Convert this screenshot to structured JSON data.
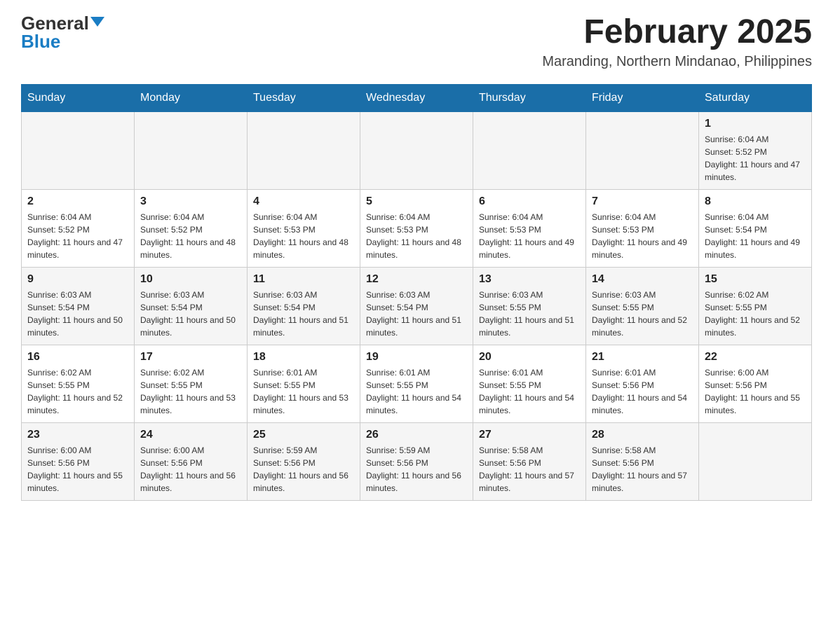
{
  "header": {
    "logo_general": "General",
    "logo_blue": "Blue",
    "month_title": "February 2025",
    "location": "Maranding, Northern Mindanao, Philippines"
  },
  "weekdays": [
    "Sunday",
    "Monday",
    "Tuesday",
    "Wednesday",
    "Thursday",
    "Friday",
    "Saturday"
  ],
  "weeks": [
    [
      {
        "day": "",
        "info": ""
      },
      {
        "day": "",
        "info": ""
      },
      {
        "day": "",
        "info": ""
      },
      {
        "day": "",
        "info": ""
      },
      {
        "day": "",
        "info": ""
      },
      {
        "day": "",
        "info": ""
      },
      {
        "day": "1",
        "info": "Sunrise: 6:04 AM\nSunset: 5:52 PM\nDaylight: 11 hours and 47 minutes."
      }
    ],
    [
      {
        "day": "2",
        "info": "Sunrise: 6:04 AM\nSunset: 5:52 PM\nDaylight: 11 hours and 47 minutes."
      },
      {
        "day": "3",
        "info": "Sunrise: 6:04 AM\nSunset: 5:52 PM\nDaylight: 11 hours and 48 minutes."
      },
      {
        "day": "4",
        "info": "Sunrise: 6:04 AM\nSunset: 5:53 PM\nDaylight: 11 hours and 48 minutes."
      },
      {
        "day": "5",
        "info": "Sunrise: 6:04 AM\nSunset: 5:53 PM\nDaylight: 11 hours and 48 minutes."
      },
      {
        "day": "6",
        "info": "Sunrise: 6:04 AM\nSunset: 5:53 PM\nDaylight: 11 hours and 49 minutes."
      },
      {
        "day": "7",
        "info": "Sunrise: 6:04 AM\nSunset: 5:53 PM\nDaylight: 11 hours and 49 minutes."
      },
      {
        "day": "8",
        "info": "Sunrise: 6:04 AM\nSunset: 5:54 PM\nDaylight: 11 hours and 49 minutes."
      }
    ],
    [
      {
        "day": "9",
        "info": "Sunrise: 6:03 AM\nSunset: 5:54 PM\nDaylight: 11 hours and 50 minutes."
      },
      {
        "day": "10",
        "info": "Sunrise: 6:03 AM\nSunset: 5:54 PM\nDaylight: 11 hours and 50 minutes."
      },
      {
        "day": "11",
        "info": "Sunrise: 6:03 AM\nSunset: 5:54 PM\nDaylight: 11 hours and 51 minutes."
      },
      {
        "day": "12",
        "info": "Sunrise: 6:03 AM\nSunset: 5:54 PM\nDaylight: 11 hours and 51 minutes."
      },
      {
        "day": "13",
        "info": "Sunrise: 6:03 AM\nSunset: 5:55 PM\nDaylight: 11 hours and 51 minutes."
      },
      {
        "day": "14",
        "info": "Sunrise: 6:03 AM\nSunset: 5:55 PM\nDaylight: 11 hours and 52 minutes."
      },
      {
        "day": "15",
        "info": "Sunrise: 6:02 AM\nSunset: 5:55 PM\nDaylight: 11 hours and 52 minutes."
      }
    ],
    [
      {
        "day": "16",
        "info": "Sunrise: 6:02 AM\nSunset: 5:55 PM\nDaylight: 11 hours and 52 minutes."
      },
      {
        "day": "17",
        "info": "Sunrise: 6:02 AM\nSunset: 5:55 PM\nDaylight: 11 hours and 53 minutes."
      },
      {
        "day": "18",
        "info": "Sunrise: 6:01 AM\nSunset: 5:55 PM\nDaylight: 11 hours and 53 minutes."
      },
      {
        "day": "19",
        "info": "Sunrise: 6:01 AM\nSunset: 5:55 PM\nDaylight: 11 hours and 54 minutes."
      },
      {
        "day": "20",
        "info": "Sunrise: 6:01 AM\nSunset: 5:55 PM\nDaylight: 11 hours and 54 minutes."
      },
      {
        "day": "21",
        "info": "Sunrise: 6:01 AM\nSunset: 5:56 PM\nDaylight: 11 hours and 54 minutes."
      },
      {
        "day": "22",
        "info": "Sunrise: 6:00 AM\nSunset: 5:56 PM\nDaylight: 11 hours and 55 minutes."
      }
    ],
    [
      {
        "day": "23",
        "info": "Sunrise: 6:00 AM\nSunset: 5:56 PM\nDaylight: 11 hours and 55 minutes."
      },
      {
        "day": "24",
        "info": "Sunrise: 6:00 AM\nSunset: 5:56 PM\nDaylight: 11 hours and 56 minutes."
      },
      {
        "day": "25",
        "info": "Sunrise: 5:59 AM\nSunset: 5:56 PM\nDaylight: 11 hours and 56 minutes."
      },
      {
        "day": "26",
        "info": "Sunrise: 5:59 AM\nSunset: 5:56 PM\nDaylight: 11 hours and 56 minutes."
      },
      {
        "day": "27",
        "info": "Sunrise: 5:58 AM\nSunset: 5:56 PM\nDaylight: 11 hours and 57 minutes."
      },
      {
        "day": "28",
        "info": "Sunrise: 5:58 AM\nSunset: 5:56 PM\nDaylight: 11 hours and 57 minutes."
      },
      {
        "day": "",
        "info": ""
      }
    ]
  ]
}
